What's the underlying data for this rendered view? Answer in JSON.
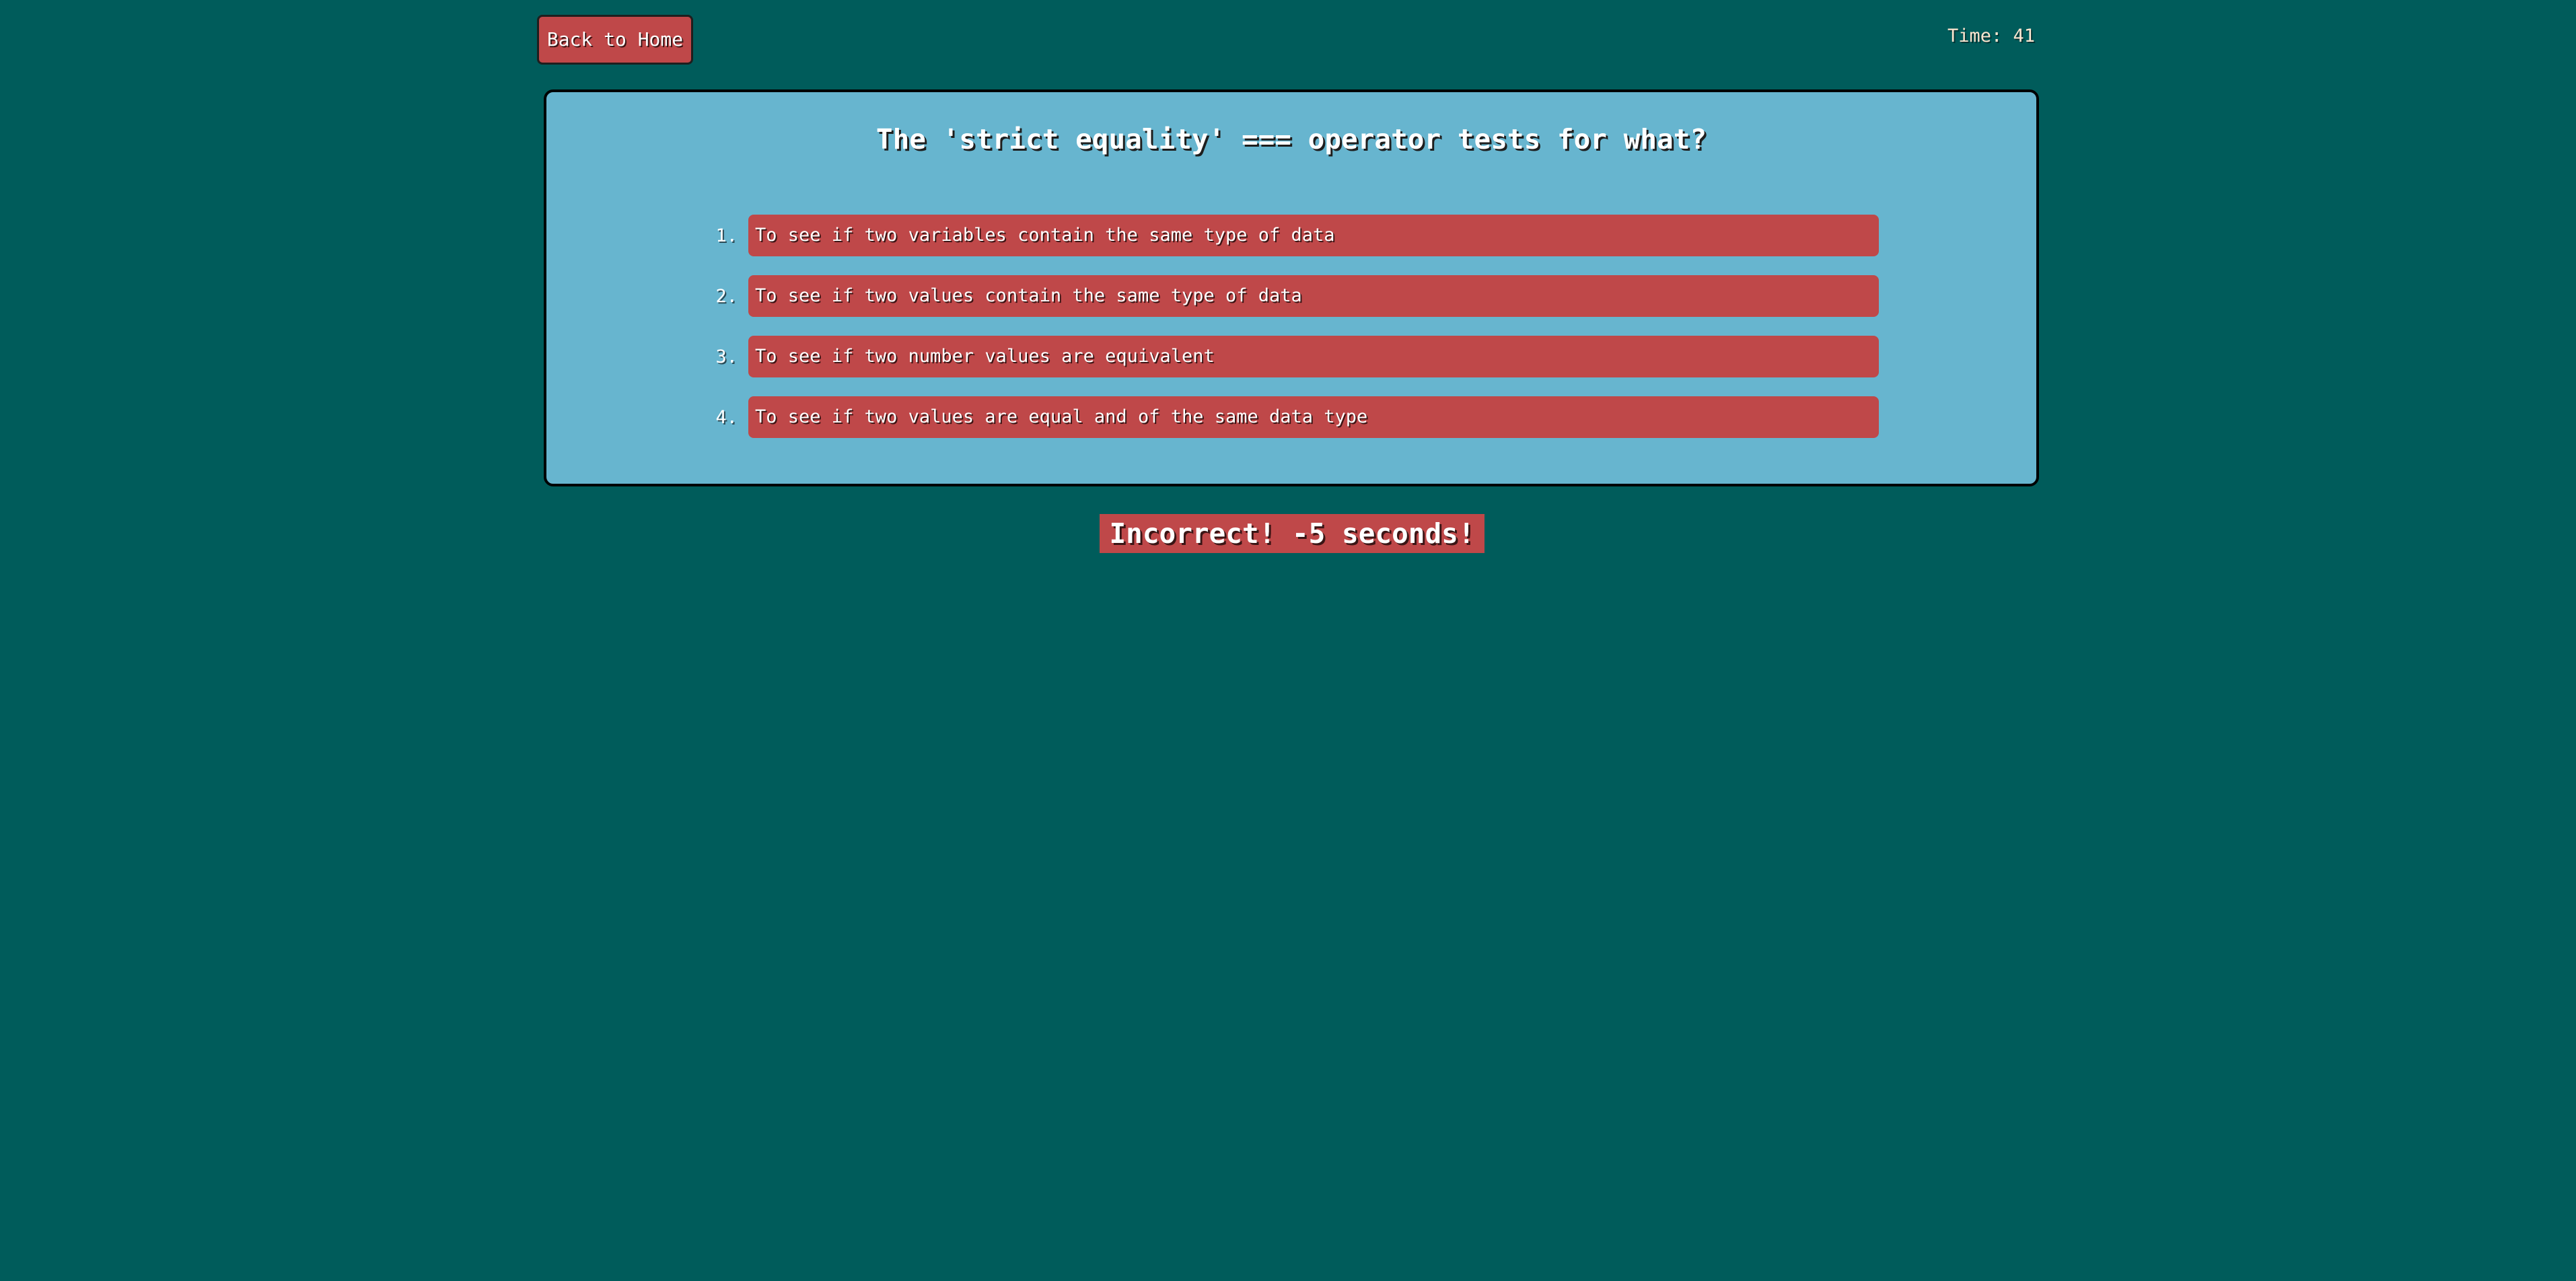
{
  "header": {
    "back_label": "Back to Home",
    "timer_text": "Time: 41"
  },
  "quiz": {
    "question": "The 'strict equality' === operator tests for what?",
    "answers": [
      {
        "number": "1.",
        "text": "To see if two variables contain the same type of data"
      },
      {
        "number": "2.",
        "text": "To see if two values contain the same type of data"
      },
      {
        "number": "3.",
        "text": "To see if two number values are equivalent"
      },
      {
        "number": "4.",
        "text": "To see if two values are equal and of the same data type"
      }
    ]
  },
  "feedback": {
    "text": "Incorrect! -5 seconds!"
  },
  "colors": {
    "background": "#005c5b",
    "card": "#67b5cf",
    "button": "#bf4849",
    "timer_text": "#ffe6d0"
  }
}
